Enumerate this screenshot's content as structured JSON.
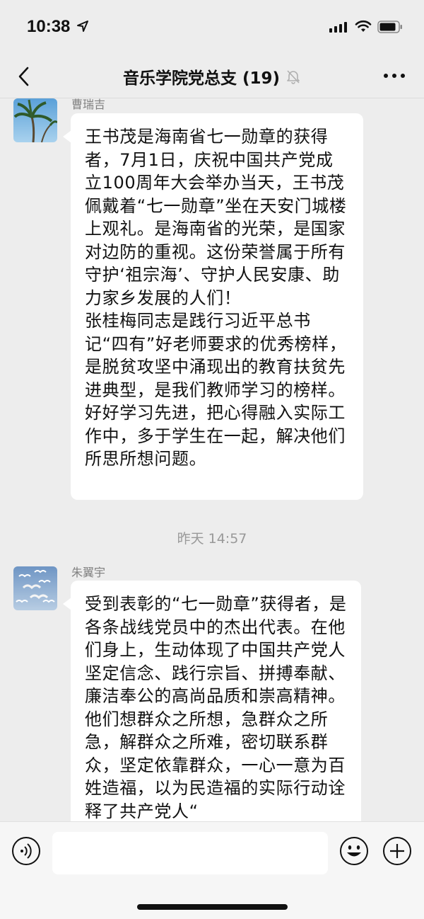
{
  "status_bar": {
    "time": "10:38"
  },
  "nav": {
    "title": "音乐学院党总支 (19)"
  },
  "messages": [
    {
      "sender": "曹瑞吉",
      "paragraphs": [
        "王书茂是海南省七一勋章的获得者，7月1日，庆祝中国共产党成立100周年大会举办当天，王书茂佩戴着“七一勋章”坐在天安门城楼上观礼。是海南省的光荣，是国家对边防的重视。这份荣誉属于所有守护‘祖宗海’、守护人民安康、助力家乡发展的人们！",
        "张桂梅同志是践行习近平总书记“四有”好老师要求的优秀榜样，是脱贫攻坚中涌现出的教育扶贫先进典型，是我们教师学习的榜样。",
        "好好学习先进，把心得融入实际工作中，多于学生在一起，解决他们所思所想问题。"
      ]
    },
    {
      "sender": "朱翼宇",
      "paragraphs": [
        "受到表彰的“七一勋章”获得者，是各条战线党员中的杰出代表。在他们身上，生动体现了中国共产党人坚定信念、践行宗旨、拼搏奉献、廉洁奉公的高尚品质和崇高精神。他们想群众之所想，急群众之所急，解群众之所难，密切联系群众，坚定依靠群众，一心一意为百姓造福，以为民造福的实际行动诠释了共产党人“"
      ]
    }
  ],
  "timestamp": "昨天 14:57",
  "input": {
    "placeholder": ""
  },
  "icons": [
    "location-arrow-icon",
    "signal-icon",
    "wifi-icon",
    "battery-icon",
    "back-icon",
    "mute-bell-icon",
    "more-icon",
    "voice-icon",
    "emoji-icon",
    "plus-icon"
  ]
}
